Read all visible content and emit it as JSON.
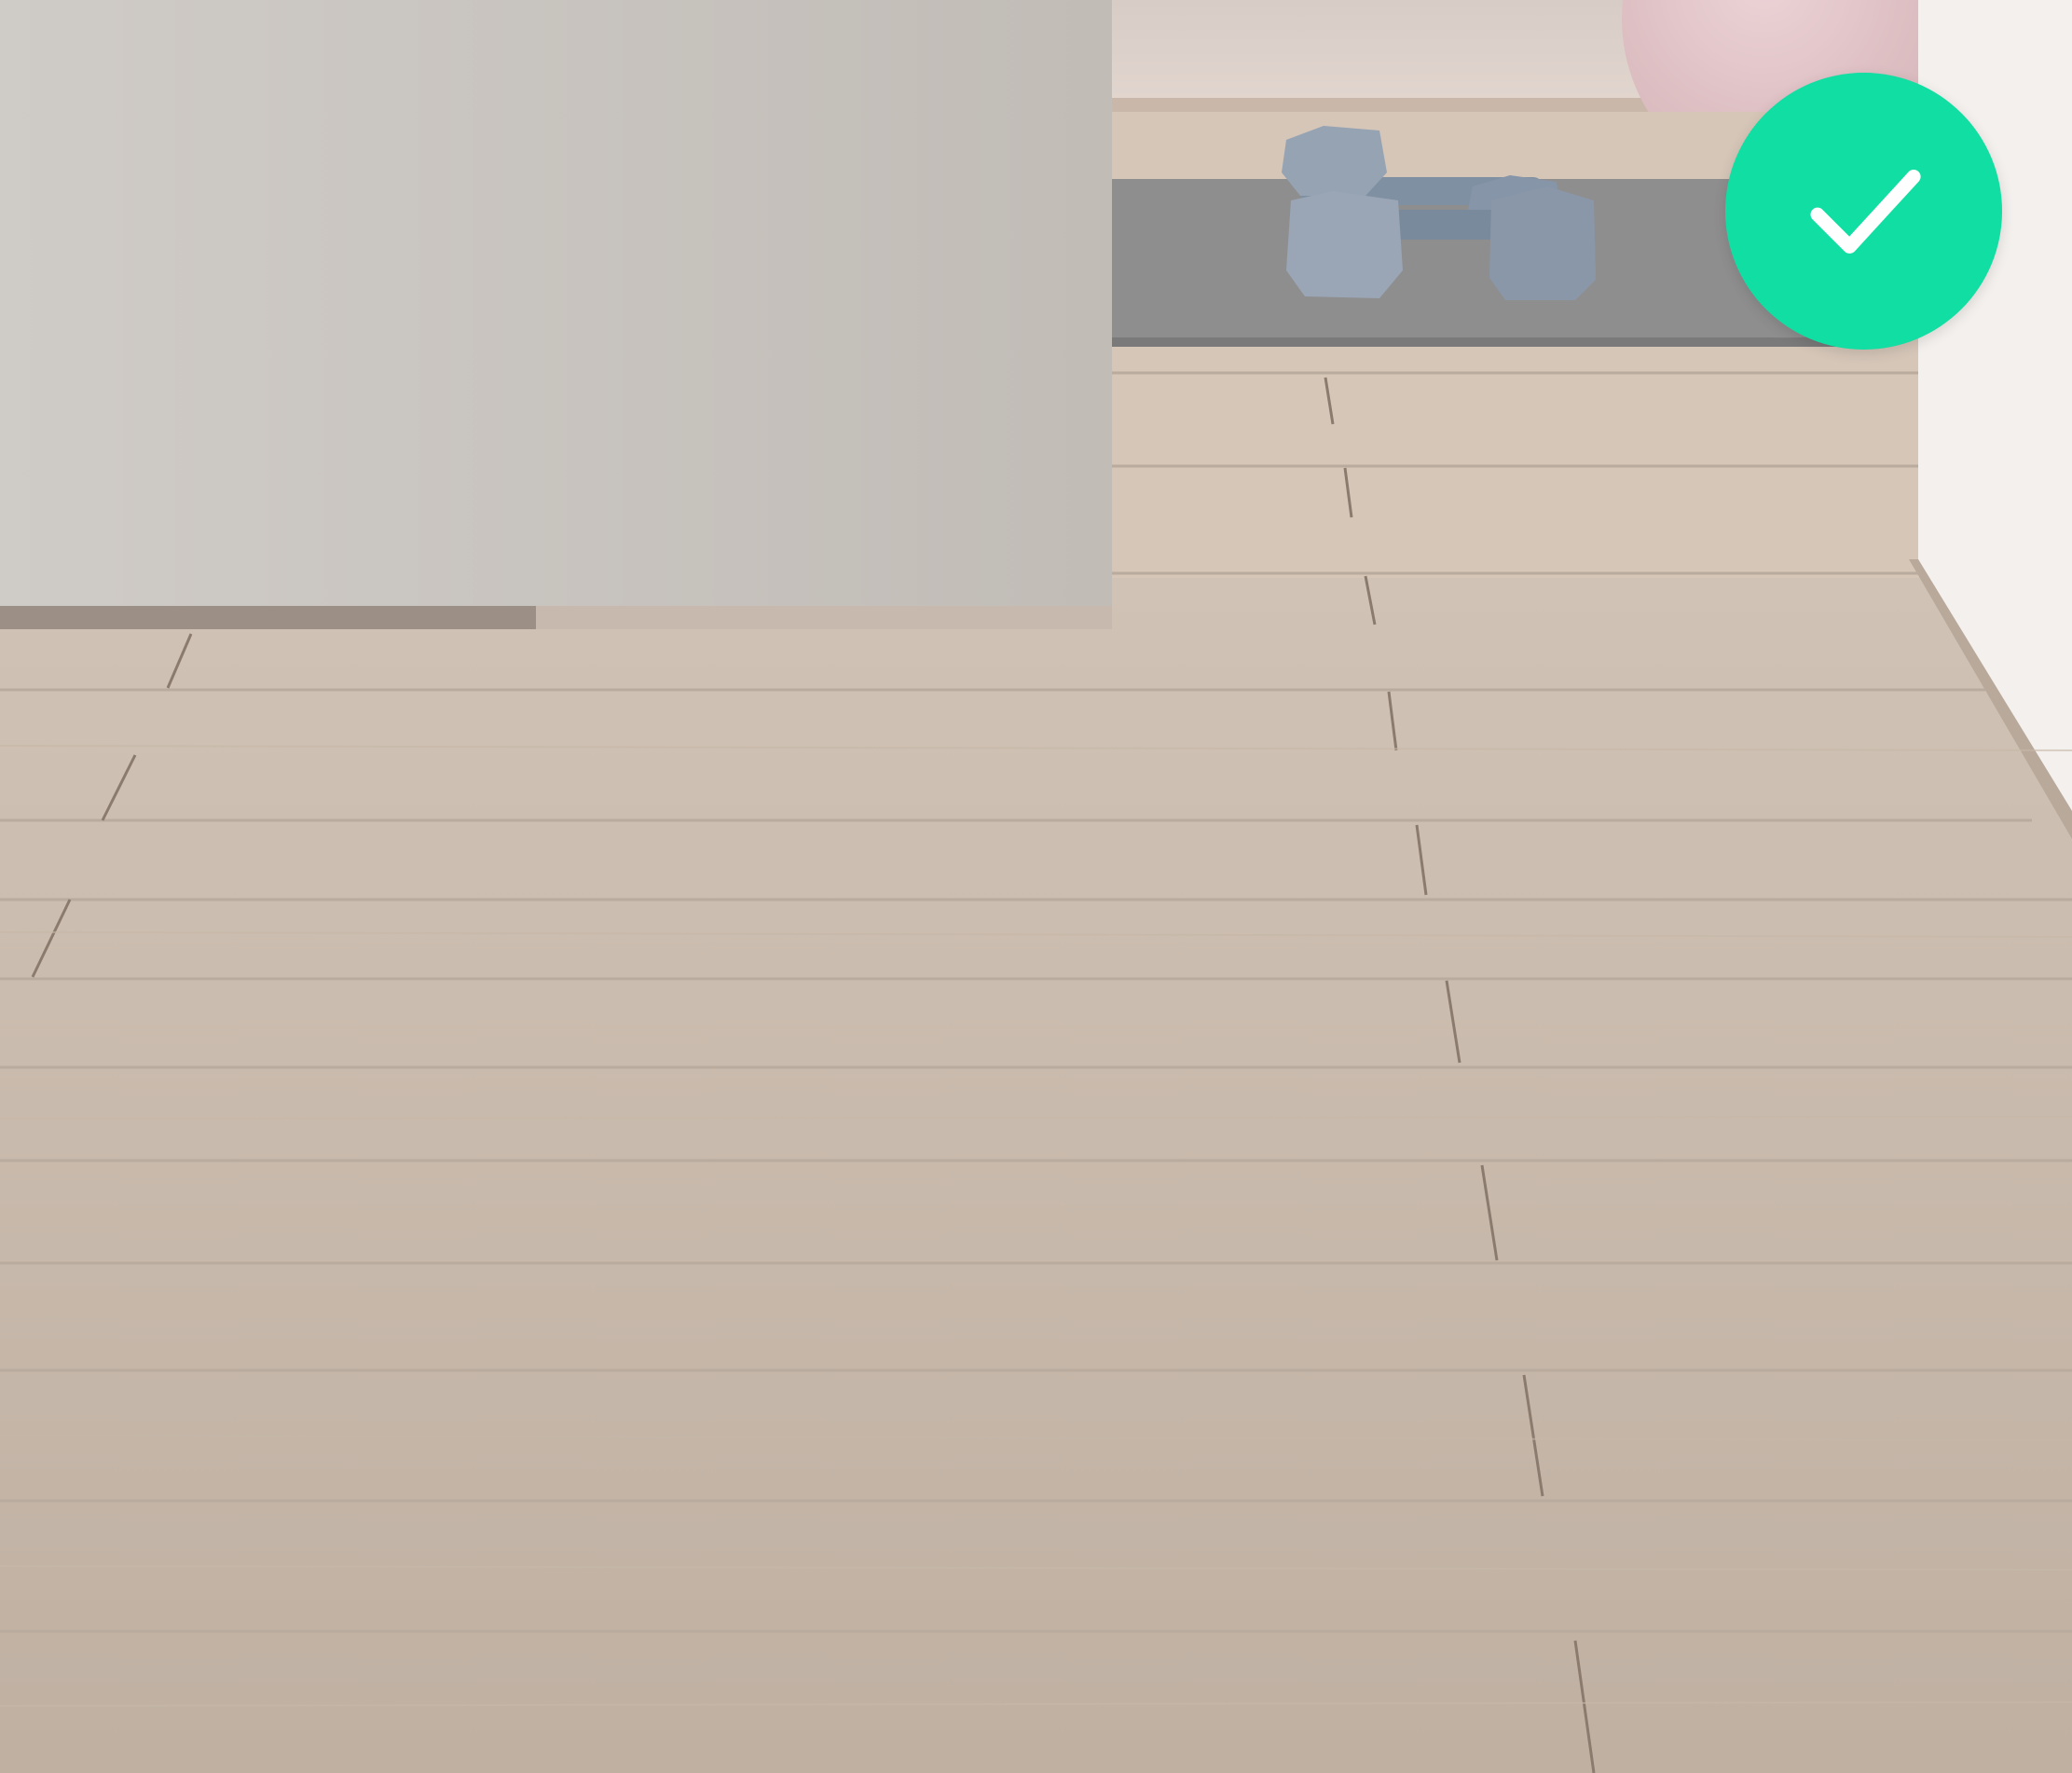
{
  "scene": {
    "description_icon": "photo-floor-selection",
    "colors": {
      "wall": "#c9c4bf",
      "floor": "#cdbfb1",
      "mat": "#8f8f90",
      "dumbbell": "#8794a6",
      "right_wall": "#f2efec",
      "ball": "#e3c5c9"
    }
  },
  "selection_badge": {
    "icon": "checkmark-icon",
    "selected": true,
    "color": "#10dea2"
  }
}
